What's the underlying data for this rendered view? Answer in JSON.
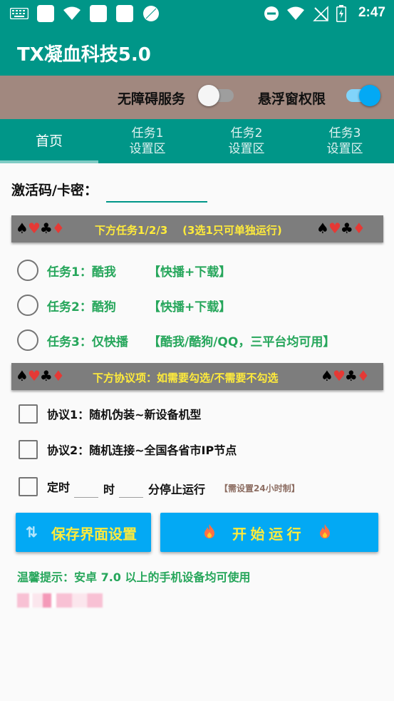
{
  "status_bar": {
    "time": "2:47",
    "icons": [
      "keyboard-icon",
      "square-icon",
      "wifi-icon",
      "square-icon",
      "square-icon",
      "circle-icon",
      "dnd-icon",
      "wifi-icon",
      "no-signal-icon",
      "battery-charging-icon"
    ]
  },
  "app": {
    "title": "TX凝血科技5.0"
  },
  "permissions": {
    "accessibility_label": "无障碍服务",
    "accessibility_enabled": false,
    "floating_label": "悬浮窗权限",
    "floating_enabled": true
  },
  "tabs": [
    {
      "line1": "首页",
      "line2": "",
      "active": true
    },
    {
      "line1": "任务1",
      "line2": "设置区",
      "active": false
    },
    {
      "line1": "任务2",
      "line2": "设置区",
      "active": false
    },
    {
      "line1": "任务3",
      "line2": "设置区",
      "active": false
    }
  ],
  "activation": {
    "label": "激活码/卡密：",
    "value": ""
  },
  "task_banner": {
    "suits": "♠♥♣♦",
    "text": "下方任务1/2/3    (3选1只可单独运行)"
  },
  "tasks": [
    {
      "name": "任务1：酷我",
      "tag": "【快播+下载】",
      "selected": false
    },
    {
      "name": "任务2：酷狗",
      "tag": "【快播+下载】",
      "selected": false
    },
    {
      "name": "任务3：仅快播",
      "tag": "【酷我/酷狗/QQ，三平台均可用】",
      "selected": false
    }
  ],
  "protocol_banner": {
    "suits": "♠♥♣♦",
    "text": "下方协议项：如需要勾选/不需要不勾选"
  },
  "protocols": [
    {
      "label": "协议1：随机伪装~新设备机型",
      "checked": false
    },
    {
      "label": "协议2：随机连接~全国各省市IP节点",
      "checked": false
    }
  ],
  "timer": {
    "label_prefix": "定时",
    "hour_label": "时",
    "minute_label": "分停止运行",
    "hour_value": "",
    "minute_value": "",
    "note": "【需设置24小时制】",
    "checked": false
  },
  "buttons": {
    "save_label": "保存界面设置",
    "start_label": "开 始 运 行"
  },
  "tip": "温馨提示：安卓 7.0 以上的手机设备均可使用",
  "colors": {
    "primary": "#009688",
    "permission_bar": "#a1887f",
    "accent_green": "#26a65b",
    "button_blue": "#03a9f4",
    "button_text": "#ffeb3b",
    "banner_gray": "#7d7d7d"
  }
}
